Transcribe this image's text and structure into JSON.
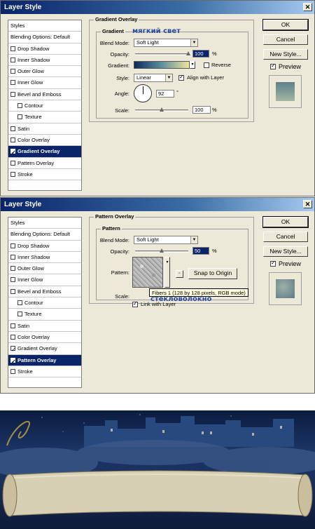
{
  "dialog1": {
    "title": "Layer Style",
    "close_icon": "close-icon",
    "styles_list": [
      {
        "label": "Styles",
        "checkbox": false,
        "checked": false,
        "indent": false,
        "selected": false
      },
      {
        "label": "Blending Options: Default",
        "checkbox": false,
        "checked": false,
        "indent": false,
        "selected": false
      },
      {
        "label": "Drop Shadow",
        "checkbox": true,
        "checked": false,
        "indent": false,
        "selected": false
      },
      {
        "label": "Inner Shadow",
        "checkbox": true,
        "checked": false,
        "indent": false,
        "selected": false
      },
      {
        "label": "Outer Glow",
        "checkbox": true,
        "checked": false,
        "indent": false,
        "selected": false
      },
      {
        "label": "Inner Glow",
        "checkbox": true,
        "checked": false,
        "indent": false,
        "selected": false
      },
      {
        "label": "Bevel and Emboss",
        "checkbox": true,
        "checked": false,
        "indent": false,
        "selected": false
      },
      {
        "label": "Contour",
        "checkbox": true,
        "checked": false,
        "indent": true,
        "selected": false
      },
      {
        "label": "Texture",
        "checkbox": true,
        "checked": false,
        "indent": true,
        "selected": false
      },
      {
        "label": "Satin",
        "checkbox": true,
        "checked": false,
        "indent": false,
        "selected": false
      },
      {
        "label": "Color Overlay",
        "checkbox": true,
        "checked": false,
        "indent": false,
        "selected": false
      },
      {
        "label": "Gradient Overlay",
        "checkbox": true,
        "checked": true,
        "indent": false,
        "selected": true
      },
      {
        "label": "Pattern Overlay",
        "checkbox": true,
        "checked": false,
        "indent": false,
        "selected": false
      },
      {
        "label": "Stroke",
        "checkbox": true,
        "checked": false,
        "indent": false,
        "selected": false
      }
    ],
    "section_title": "Gradient Overlay",
    "group_title": "Gradient",
    "annotation": "мягкий свет",
    "blend_mode_label": "Blend Mode:",
    "blend_mode_value": "Soft Light",
    "opacity_label": "Opacity:",
    "opacity_value": "100",
    "opacity_fraction": 1.0,
    "percent": "%",
    "gradient_label": "Gradient:",
    "reverse_label": "Reverse",
    "reverse_checked": false,
    "style_label": "Style:",
    "style_value": "Linear",
    "align_label": "Align with Layer",
    "align_checked": true,
    "angle_label": "Angle:",
    "angle_value": "92",
    "degree": "°",
    "scale_label": "Scale:",
    "scale_value": "100",
    "scale_fraction": 0.5,
    "ok_label": "OK",
    "cancel_label": "Cancel",
    "new_style_label": "New Style...",
    "preview_label": "Preview",
    "preview_checked": true
  },
  "dialog2": {
    "title": "Layer Style",
    "close_icon": "close-icon",
    "styles_list": [
      {
        "label": "Styles",
        "checkbox": false,
        "checked": false,
        "indent": false,
        "selected": false
      },
      {
        "label": "Blending Options: Default",
        "checkbox": false,
        "checked": false,
        "indent": false,
        "selected": false
      },
      {
        "label": "Drop Shadow",
        "checkbox": true,
        "checked": false,
        "indent": false,
        "selected": false
      },
      {
        "label": "Inner Shadow",
        "checkbox": true,
        "checked": false,
        "indent": false,
        "selected": false
      },
      {
        "label": "Outer Glow",
        "checkbox": true,
        "checked": false,
        "indent": false,
        "selected": false
      },
      {
        "label": "Inner Glow",
        "checkbox": true,
        "checked": false,
        "indent": false,
        "selected": false
      },
      {
        "label": "Bevel and Emboss",
        "checkbox": true,
        "checked": false,
        "indent": false,
        "selected": false
      },
      {
        "label": "Contour",
        "checkbox": true,
        "checked": false,
        "indent": true,
        "selected": false
      },
      {
        "label": "Texture",
        "checkbox": true,
        "checked": false,
        "indent": true,
        "selected": false
      },
      {
        "label": "Satin",
        "checkbox": true,
        "checked": false,
        "indent": false,
        "selected": false
      },
      {
        "label": "Color Overlay",
        "checkbox": true,
        "checked": false,
        "indent": false,
        "selected": false
      },
      {
        "label": "Gradient Overlay",
        "checkbox": true,
        "checked": true,
        "indent": false,
        "selected": false
      },
      {
        "label": "Pattern Overlay",
        "checkbox": true,
        "checked": true,
        "indent": false,
        "selected": true
      },
      {
        "label": "Stroke",
        "checkbox": true,
        "checked": false,
        "indent": false,
        "selected": false
      }
    ],
    "section_title": "Pattern Overlay",
    "group_title": "Pattern",
    "blend_mode_label": "Blend Mode:",
    "blend_mode_value": "Soft Light",
    "opacity_label": "Opacity:",
    "opacity_value": "50",
    "opacity_fraction": 0.5,
    "percent": "%",
    "pattern_label": "Pattern:",
    "snap_label": "Snap to Origin",
    "tooltip": "Fibers 1 (128 by 128 pixels, RGB mode)",
    "annotation": "стекловолокно",
    "scale_label": "Scale:",
    "link_label": "Link with Layer",
    "link_checked": true,
    "ok_label": "OK",
    "cancel_label": "Cancel",
    "new_style_label": "New Style...",
    "preview_label": "Preview",
    "preview_checked": true
  },
  "colors": {
    "title_bar": "#0a246a",
    "dialog_bg": "#ece9d8",
    "selection": "#0a246a",
    "annotation": "#2a4aa4",
    "scroll_paper": "#d8d0b4"
  },
  "scene": {
    "description_icons": [
      "night-sky",
      "town-silhouette",
      "clouds",
      "parchment-scroll"
    ]
  }
}
